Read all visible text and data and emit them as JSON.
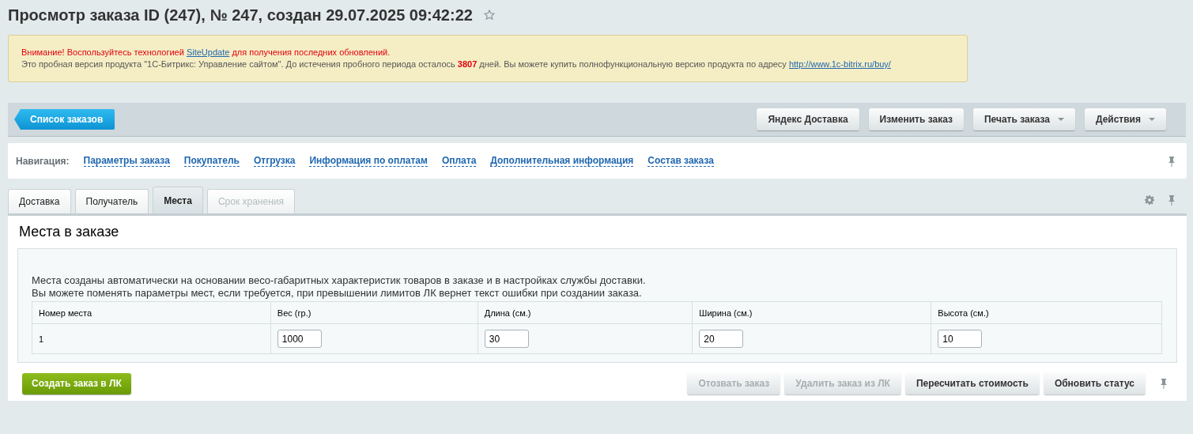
{
  "title": "Просмотр заказа ID (247), № 247, создан 29.07.2025 09:42:22",
  "favorite": false,
  "notice": {
    "lines": [
      {
        "kind": "warning",
        "parts": [
          {
            "kind": "text",
            "text": "Внимание! Воспользуйтесь технологией "
          },
          {
            "kind": "link",
            "text": "SiteUpdate"
          },
          {
            "kind": "text",
            "text": " для получения последних обновлений."
          }
        ]
      },
      {
        "kind": "info",
        "parts": [
          {
            "kind": "text",
            "text": "Это пробная версия продукта \"1С-Битрикс: Управление сайтом\". До истечения пробного периода осталось "
          },
          {
            "kind": "number",
            "text": "3807"
          },
          {
            "kind": "text",
            "text": " дней. Вы можете купить полнофункциональную версию продукта по адресу "
          },
          {
            "kind": "link",
            "text": "http://www.1c-bitrix.ru/buy/"
          }
        ]
      }
    ]
  },
  "toolbar": {
    "back_button": "Список заказов",
    "buttons": [
      {
        "label": "Яндекс Доставка",
        "dropdown": false
      },
      {
        "label": "Изменить заказ",
        "dropdown": false
      },
      {
        "label": "Печать заказа",
        "dropdown": true
      },
      {
        "label": "Действия",
        "dropdown": true
      }
    ]
  },
  "navigation": {
    "label": "Навигация:",
    "links": [
      "Параметры заказа",
      "Покупатель",
      "Отгрузка",
      "Информация по оплатам",
      "Оплата",
      "Дополнительная информация",
      "Состав заказа"
    ]
  },
  "tabs": [
    {
      "label": "Доставка",
      "selected": false,
      "disabled": false
    },
    {
      "label": "Получатель",
      "selected": false,
      "disabled": false
    },
    {
      "label": "Места",
      "selected": true,
      "disabled": false
    },
    {
      "label": "Срок хранения",
      "selected": false,
      "disabled": true
    }
  ],
  "section": {
    "title": "Места в заказе",
    "description": [
      "Места созданы автоматически на основании весо-габаритных характеристик товаров в заказе и в настройках службы доставки.",
      "Вы можете поменять параметры мест, если требуется, при превышении лимитов ЛК вернет текст ошибки при создании заказа."
    ],
    "table": {
      "columns": [
        "Номер места",
        "Вес (гр.)",
        "Длина (см.)",
        "Ширина (см.)",
        "Высота (см.)"
      ],
      "rows": [
        {
          "number": "1",
          "values": [
            "1000",
            "30",
            "20",
            "10"
          ]
        }
      ]
    }
  },
  "actions": {
    "primary": "Создать заказ в ЛК",
    "buttons": [
      {
        "label": "Отозвать заказ",
        "disabled": true
      },
      {
        "label": "Удалить заказ из ЛК",
        "disabled": true
      },
      {
        "label": "Пересчитать стоимость",
        "disabled": false
      },
      {
        "label": "Обновить статус",
        "disabled": false
      }
    ]
  }
}
